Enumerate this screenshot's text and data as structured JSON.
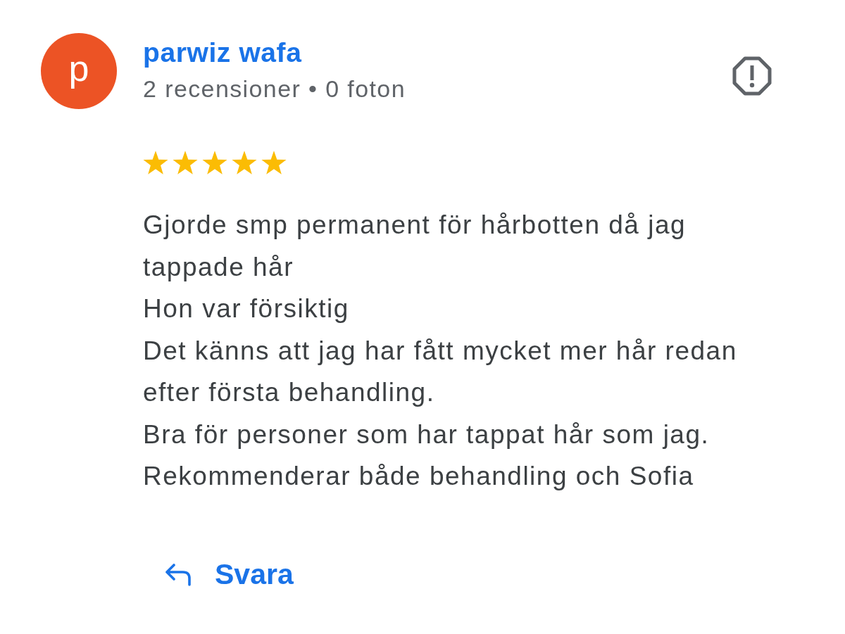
{
  "reviewer": {
    "avatar_letter": "p",
    "name": "parwiz wafa",
    "stats": "2 recensioner • 0 foton"
  },
  "review": {
    "stars": 5,
    "text": "Gjorde smp permanent för hårbotten då jag tappade hår\nHon var försiktig\nDet känns att jag har fått mycket mer hår redan efter första behandling.\nBra för personer som har tappat hår som jag.\nRekommenderar både behandling och Sofia"
  },
  "actions": [
    {
      "kind": "reply",
      "label": "Svara"
    }
  ]
}
